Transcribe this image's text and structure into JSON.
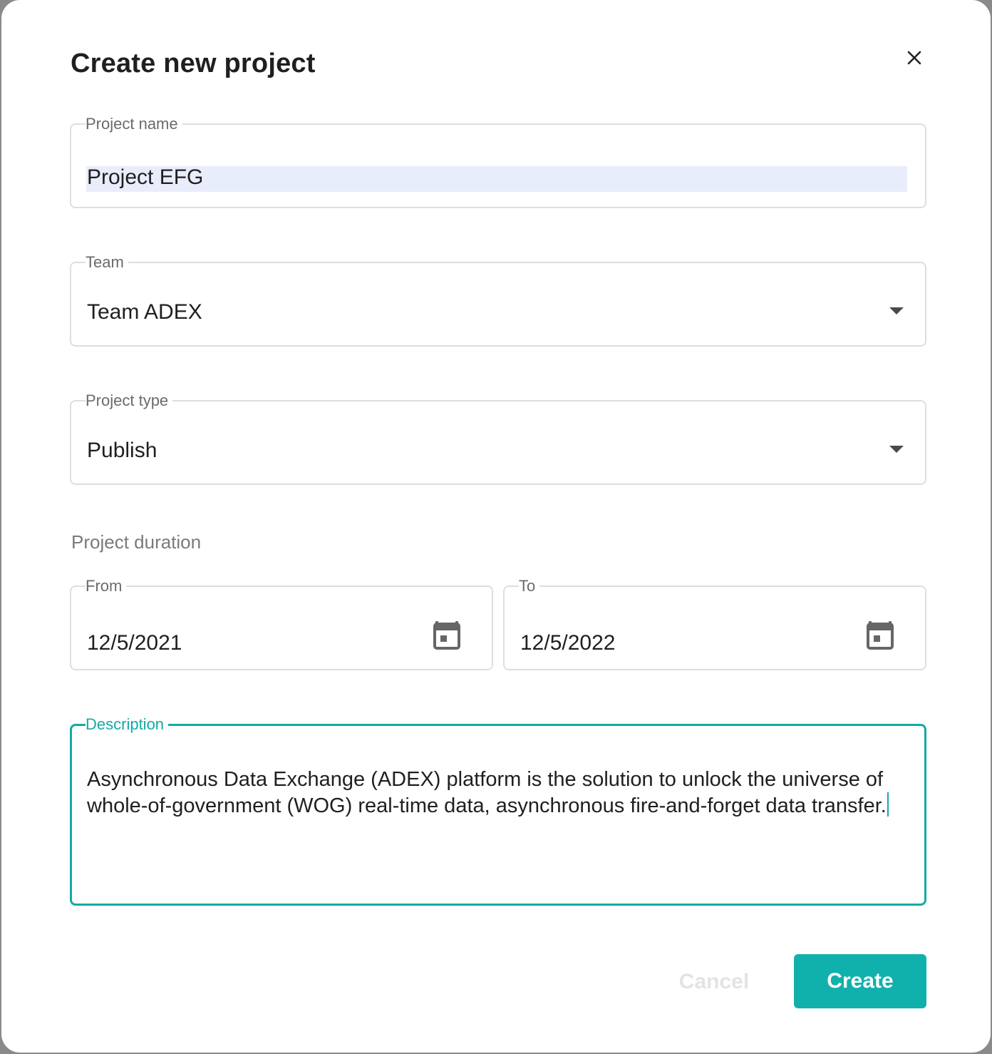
{
  "dialog": {
    "title": "Create new project",
    "close_icon": "close-icon"
  },
  "fields": {
    "project_name": {
      "label": "Project name",
      "value": "Project EFG"
    },
    "team": {
      "label": "Team",
      "value": "Team ADEX",
      "icon": "chevron-down-icon"
    },
    "project_type": {
      "label": "Project type",
      "value": "Publish",
      "icon": "chevron-down-icon"
    },
    "duration": {
      "label": "Project duration",
      "from": {
        "label": "From",
        "value": "12/5/2021",
        "icon": "calendar-icon"
      },
      "to": {
        "label": "To",
        "value": "12/5/2022",
        "icon": "calendar-icon"
      }
    },
    "description": {
      "label": "Description",
      "value": "Asynchronous Data Exchange (ADEX) platform is the solution to unlock the universe of whole-of-government (WOG) real-time data, asynchronous fire-and-forget data transfer."
    }
  },
  "actions": {
    "cancel_label": "Cancel",
    "create_label": "Create"
  },
  "colors": {
    "accent": "#10b1ac",
    "selection_highlight": "#e9edfb",
    "border": "#dedede",
    "disabled_text": "#e3e3e3"
  }
}
